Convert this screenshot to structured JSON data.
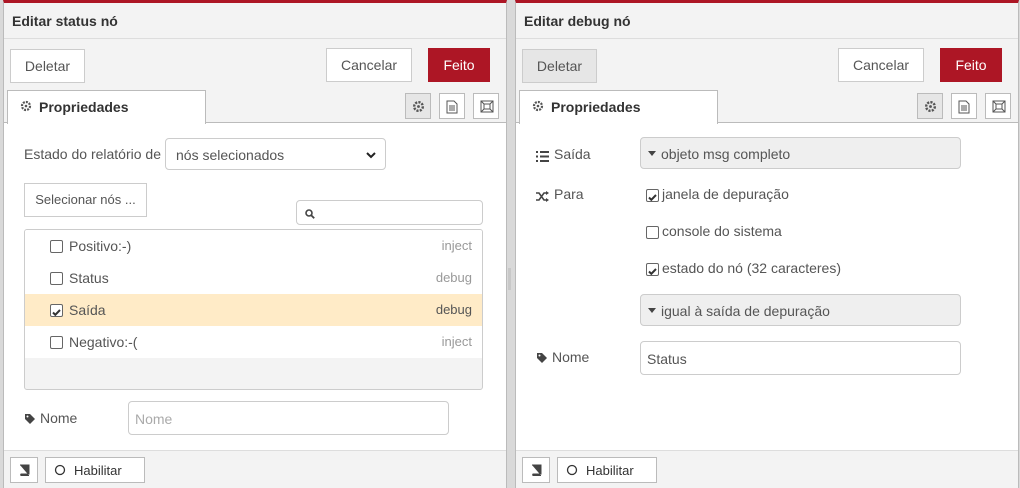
{
  "left": {
    "title": "Editar status nó",
    "toolbar": {
      "delete": "Deletar",
      "cancel": "Cancelar",
      "done": "Feito"
    },
    "tab": "Propriedades",
    "report_label": "Estado do relatório de",
    "report_value": "nós selecionados",
    "select_nodes": "Selecionar nós ...",
    "search_value": "",
    "nodes": [
      {
        "name": "Positivo:-)",
        "type": "inject",
        "checked": false,
        "selected": false
      },
      {
        "name": "Status",
        "type": "debug",
        "checked": false,
        "selected": false
      },
      {
        "name": "Saída",
        "type": "debug",
        "checked": true,
        "selected": true
      },
      {
        "name": "Negativo:-(",
        "type": "inject",
        "checked": false,
        "selected": false
      }
    ],
    "name_label": "Nome",
    "name_placeholder": "Nome",
    "enable": "Habilitar"
  },
  "right": {
    "title": "Editar debug nó",
    "toolbar": {
      "delete": "Deletar",
      "cancel": "Cancelar",
      "done": "Feito"
    },
    "tab": "Propriedades",
    "output_label": "Saída",
    "output_value": "objeto msg completo",
    "to_label": "Para",
    "options": [
      {
        "label": "janela de depuração",
        "checked": true
      },
      {
        "label": "console do sistema",
        "checked": false
      },
      {
        "label": "estado do nó (32 caracteres)",
        "checked": true
      }
    ],
    "status_value": "igual à saída de depuração",
    "name_label": "Nome",
    "name_value": "Status",
    "enable": "Habilitar"
  },
  "colors": {
    "accent": "#ad1625",
    "highlight": "#ffebc7",
    "toolbar": "#f3f3f3"
  },
  "icons": [
    "gear-icon",
    "description-icon",
    "layout-icon",
    "search-icon",
    "tag-icon",
    "list-icon",
    "shuffle-icon",
    "book-icon",
    "circle-icon",
    "chevron-down-icon",
    "caret-down-icon",
    "checkmark-icon"
  ]
}
